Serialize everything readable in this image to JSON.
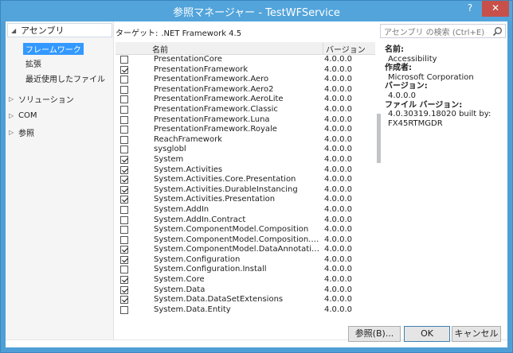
{
  "window": {
    "title": "参照マネージャー - TestWFService",
    "help_label": "?",
    "close_label": "✕"
  },
  "nav": {
    "header": "アセンブリ",
    "sub_items": [
      {
        "label": "フレームワーク",
        "selected": true
      },
      {
        "label": "拡張",
        "selected": false
      },
      {
        "label": "最近使用したファイル",
        "selected": false
      }
    ],
    "groups": [
      {
        "label": "ソリューション"
      },
      {
        "label": "COM"
      },
      {
        "label": "参照"
      }
    ]
  },
  "target": {
    "label": "ターゲット:",
    "value": ".NET Framework 4.5"
  },
  "search": {
    "placeholder": "アセンブリ の検索 (Ctrl+E)",
    "icon": "search-icon"
  },
  "list": {
    "columns": {
      "name": "名前",
      "version": "バージョン"
    },
    "rows": [
      {
        "checked": false,
        "name": "PresentationCore",
        "version": "4.0.0.0"
      },
      {
        "checked": true,
        "name": "PresentationFramework",
        "version": "4.0.0.0"
      },
      {
        "checked": false,
        "name": "PresentationFramework.Aero",
        "version": "4.0.0.0"
      },
      {
        "checked": false,
        "name": "PresentationFramework.Aero2",
        "version": "4.0.0.0"
      },
      {
        "checked": false,
        "name": "PresentationFramework.AeroLite",
        "version": "4.0.0.0"
      },
      {
        "checked": false,
        "name": "PresentationFramework.Classic",
        "version": "4.0.0.0"
      },
      {
        "checked": false,
        "name": "PresentationFramework.Luna",
        "version": "4.0.0.0"
      },
      {
        "checked": false,
        "name": "PresentationFramework.Royale",
        "version": "4.0.0.0"
      },
      {
        "checked": false,
        "name": "ReachFramework",
        "version": "4.0.0.0"
      },
      {
        "checked": false,
        "name": "sysglobl",
        "version": "4.0.0.0"
      },
      {
        "checked": true,
        "name": "System",
        "version": "4.0.0.0"
      },
      {
        "checked": true,
        "name": "System.Activities",
        "version": "4.0.0.0"
      },
      {
        "checked": true,
        "name": "System.Activities.Core.Presentation",
        "version": "4.0.0.0"
      },
      {
        "checked": true,
        "name": "System.Activities.DurableInstancing",
        "version": "4.0.0.0"
      },
      {
        "checked": true,
        "name": "System.Activities.Presentation",
        "version": "4.0.0.0"
      },
      {
        "checked": false,
        "name": "System.AddIn",
        "version": "4.0.0.0"
      },
      {
        "checked": false,
        "name": "System.AddIn.Contract",
        "version": "4.0.0.0"
      },
      {
        "checked": false,
        "name": "System.ComponentModel.Composition",
        "version": "4.0.0.0"
      },
      {
        "checked": false,
        "name": "System.ComponentModel.Composition.R…",
        "version": "4.0.0.0"
      },
      {
        "checked": true,
        "name": "System.ComponentModel.DataAnnotations",
        "version": "4.0.0.0"
      },
      {
        "checked": true,
        "name": "System.Configuration",
        "version": "4.0.0.0"
      },
      {
        "checked": false,
        "name": "System.Configuration.Install",
        "version": "4.0.0.0"
      },
      {
        "checked": true,
        "name": "System.Core",
        "version": "4.0.0.0"
      },
      {
        "checked": true,
        "name": "System.Data",
        "version": "4.0.0.0"
      },
      {
        "checked": true,
        "name": "System.Data.DataSetExtensions",
        "version": "4.0.0.0"
      },
      {
        "checked": false,
        "name": "System.Data.Entity",
        "version": "4.0.0.0"
      }
    ]
  },
  "details": {
    "name_label": "名前:",
    "name_value": "Accessibility",
    "author_label": "作成者:",
    "author_value": "Microsoft Corporation",
    "version_label": "バージョン:",
    "version_value": "4.0.0.0",
    "file_version_label": "ファイル バージョン:",
    "file_version_value_1": "4.0.30319.18020 built by:",
    "file_version_value_2": "FX45RTMGDR"
  },
  "buttons": {
    "browse": "参照(B)...",
    "ok": "OK",
    "cancel": "キャンセル"
  },
  "colors": {
    "titlebar": "#52a4db",
    "selection": "#3399ff",
    "close": "#c7504b"
  }
}
